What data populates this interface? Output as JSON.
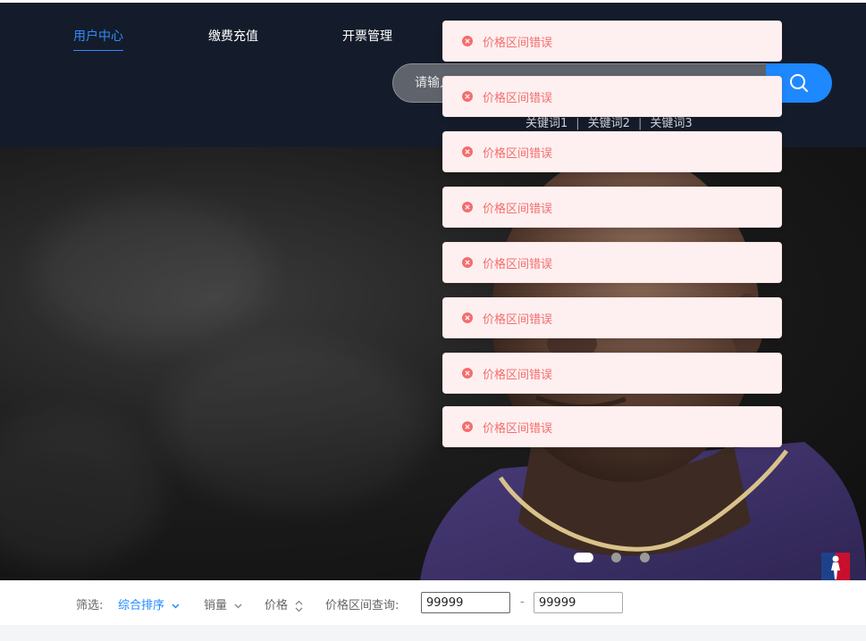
{
  "nav": {
    "items": [
      {
        "label": "用户中心",
        "active": true
      },
      {
        "label": "缴费充值",
        "active": false
      },
      {
        "label": "开票管理",
        "active": false
      }
    ]
  },
  "search": {
    "placeholder": "请输入",
    "value": "",
    "icon": "search-icon",
    "keywords": [
      "关键词1",
      "关键词2",
      "关键词3"
    ],
    "separator": "|"
  },
  "banner": {
    "slide_count": 3,
    "active_slide": 1,
    "logo": "nba-logo"
  },
  "toasts": [
    {
      "type": "error",
      "icon": "error-circle-icon",
      "message": "价格区间错误"
    },
    {
      "type": "error",
      "icon": "error-circle-icon",
      "message": "价格区间错误"
    },
    {
      "type": "error",
      "icon": "error-circle-icon",
      "message": "价格区间错误"
    },
    {
      "type": "error",
      "icon": "error-circle-icon",
      "message": "价格区间错误"
    },
    {
      "type": "error",
      "icon": "error-circle-icon",
      "message": "价格区间错误"
    },
    {
      "type": "error",
      "icon": "error-circle-icon",
      "message": "价格区间错误"
    },
    {
      "type": "error",
      "icon": "error-circle-icon",
      "message": "价格区间错误"
    },
    {
      "type": "error",
      "icon": "error-circle-icon",
      "message": "价格区间错误"
    }
  ],
  "filter": {
    "label": "筛选:",
    "sort_label": "综合排序",
    "sales_label": "销量",
    "price_label": "价格",
    "range_label": "价格区间查询:",
    "range_separator": "-",
    "min_value": "99999",
    "max_value": "99999"
  },
  "colors": {
    "accent": "#1e88ff",
    "nav_background": "#141c2b",
    "error_text": "#f56c6c",
    "error_background": "#fef0f0"
  }
}
